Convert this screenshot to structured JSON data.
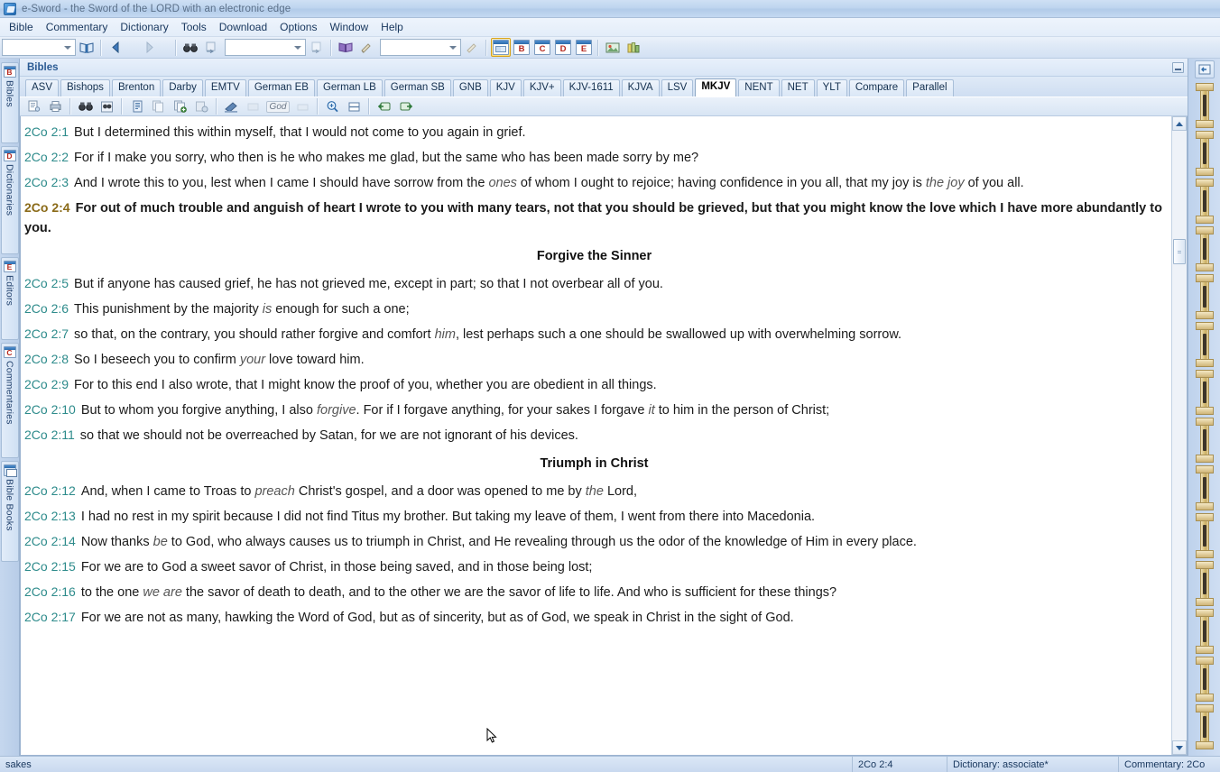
{
  "window": {
    "title": "e-Sword - the Sword of the LORD with an electronic edge",
    "app_icon": "sword-icon"
  },
  "menubar": {
    "items": [
      {
        "label": "Bible"
      },
      {
        "label": "Commentary"
      },
      {
        "label": "Dictionary"
      },
      {
        "label": "Tools"
      },
      {
        "label": "Download"
      },
      {
        "label": "Options"
      },
      {
        "label": "Window"
      },
      {
        "label": "Help"
      }
    ]
  },
  "toolbar": {
    "verse_combo_value": "",
    "search_combo_value": "",
    "topic_combo_value": "",
    "buttons": {
      "open_bible": "book-open-icon",
      "back": "back-arrow-icon",
      "back_dropdown": "chevron-down-icon",
      "forward": "forward-arrow-icon",
      "forward_dropdown": "chevron-down-icon",
      "search": "binoculars-icon",
      "search_go": "search-go-icon",
      "topic_go": "topic-go-icon",
      "dictionary": "purple-book-icon",
      "dictionary_edit": "pencil-icon",
      "last_go": "go-icon",
      "layout": "layout-icon",
      "window_b": "B",
      "window_c": "C",
      "window_d": "D",
      "window_e": "E",
      "graphic": "picture-icon",
      "charts": "charts-icon"
    }
  },
  "sidebar_left": {
    "items": [
      {
        "label": "Bibles",
        "icon": "B"
      },
      {
        "label": "Dictionaries",
        "icon": "D"
      },
      {
        "label": "Editors",
        "icon": "E"
      },
      {
        "label": "Commentaries",
        "icon": "C"
      },
      {
        "label": "Bible Books",
        "icon": "book-icon"
      }
    ]
  },
  "sidebar_right": {
    "top_button": "dock-icon",
    "scroll_icons": [
      "scroll-icon",
      "scroll-icon",
      "scroll-icon",
      "scroll-icon",
      "scroll-icon",
      "scroll-icon",
      "scroll-icon",
      "scroll-icon",
      "scroll-icon",
      "scroll-icon",
      "scroll-icon",
      "scroll-icon",
      "scroll-icon",
      "scroll-icon"
    ]
  },
  "panel": {
    "title": "Bibles",
    "minimize_icon": "minimize-icon"
  },
  "tabs": [
    {
      "label": "ASV",
      "active": false
    },
    {
      "label": "Bishops",
      "active": false
    },
    {
      "label": "Brenton",
      "active": false
    },
    {
      "label": "Darby",
      "active": false
    },
    {
      "label": "EMTV",
      "active": false
    },
    {
      "label": "German EB",
      "active": false
    },
    {
      "label": "German LB",
      "active": false
    },
    {
      "label": "German SB",
      "active": false
    },
    {
      "label": "GNB",
      "active": false
    },
    {
      "label": "KJV",
      "active": false
    },
    {
      "label": "KJV+",
      "active": false
    },
    {
      "label": "KJV-1611",
      "active": false
    },
    {
      "label": "KJVA",
      "active": false
    },
    {
      "label": "LSV",
      "active": false
    },
    {
      "label": "MKJV",
      "active": true
    },
    {
      "label": "NENT",
      "active": false
    },
    {
      "label": "NET",
      "active": false
    },
    {
      "label": "YLT",
      "active": false
    },
    {
      "label": "Compare",
      "active": false
    },
    {
      "label": "Parallel",
      "active": false
    }
  ],
  "subtoolbar": {
    "buttons": [
      "page-setup-icon",
      "print-icon",
      "search-icon",
      "search-all-icon",
      "copy-verse-icon",
      "copy-icon",
      "copy-add-icon",
      "copy-special-icon",
      "highlight-icon",
      "highlight-color-icon",
      "god-words-icon",
      "eraser-icon",
      "zoom-in-icon",
      "split-view-icon",
      "prev-chapter-icon",
      "next-chapter-icon"
    ]
  },
  "reader": {
    "blocks": [
      {
        "type": "verse",
        "ref": "2Co 2:1",
        "current": false,
        "parts": [
          {
            "t": "But I determined this within myself, that I would not come to you again in grief."
          }
        ]
      },
      {
        "type": "verse",
        "ref": "2Co 2:2",
        "current": false,
        "parts": [
          {
            "t": "For if I make you sorry, who then is he who makes me glad, but the same who has been made sorry by me?"
          }
        ]
      },
      {
        "type": "verse",
        "ref": "2Co 2:3",
        "current": false,
        "parts": [
          {
            "t": "And I wrote this to you, lest when I came I should have sorrow from the "
          },
          {
            "t": "ones",
            "i": true
          },
          {
            "t": " of whom I ought to rejoice; having confidence in you all, that my joy is "
          },
          {
            "t": "the joy",
            "i": true
          },
          {
            "t": " of you all."
          }
        ]
      },
      {
        "type": "verse",
        "ref": "2Co 2:4",
        "current": true,
        "parts": [
          {
            "t": "For out of much trouble and anguish of heart I wrote to you with many tears, not that you should be grieved, but that you might know the love which I have more abundantly to you."
          }
        ]
      },
      {
        "type": "heading",
        "text": "Forgive the Sinner"
      },
      {
        "type": "verse",
        "ref": "2Co 2:5",
        "current": false,
        "parts": [
          {
            "t": "But if anyone has caused grief, he has not grieved me, except in part; so that I not overbear all of you."
          }
        ]
      },
      {
        "type": "verse",
        "ref": "2Co 2:6",
        "current": false,
        "parts": [
          {
            "t": "This punishment by the majority "
          },
          {
            "t": "is",
            "i": true
          },
          {
            "t": " enough for such a one;"
          }
        ]
      },
      {
        "type": "verse",
        "ref": "2Co 2:7",
        "current": false,
        "parts": [
          {
            "t": "so that, on the contrary, you should rather forgive and comfort "
          },
          {
            "t": "him",
            "i": true
          },
          {
            "t": ", lest perhaps such a one should be swallowed up with overwhelming sorrow."
          }
        ]
      },
      {
        "type": "verse",
        "ref": "2Co 2:8",
        "current": false,
        "parts": [
          {
            "t": "So I beseech you to confirm "
          },
          {
            "t": "your",
            "i": true
          },
          {
            "t": " love toward him."
          }
        ]
      },
      {
        "type": "verse",
        "ref": "2Co 2:9",
        "current": false,
        "parts": [
          {
            "t": "For to this end I also wrote, that I might know the proof of you, whether you are obedient in all things."
          }
        ]
      },
      {
        "type": "verse",
        "ref": "2Co 2:10",
        "current": false,
        "parts": [
          {
            "t": "But to whom you forgive anything, I also "
          },
          {
            "t": "forgive",
            "i": true
          },
          {
            "t": ". For if I forgave anything, for your sakes I forgave "
          },
          {
            "t": "it",
            "i": true
          },
          {
            "t": " to him in the person of Christ;"
          }
        ]
      },
      {
        "type": "verse",
        "ref": "2Co 2:11",
        "current": false,
        "parts": [
          {
            "t": "so that we should not be overreached by Satan, for we are not ignorant of his devices."
          }
        ]
      },
      {
        "type": "heading",
        "text": "Triumph in Christ"
      },
      {
        "type": "verse",
        "ref": "2Co 2:12",
        "current": false,
        "parts": [
          {
            "t": "And, when I came to Troas to "
          },
          {
            "t": "preach",
            "i": true
          },
          {
            "t": " Christ's gospel, and a door was opened to me by "
          },
          {
            "t": "the",
            "i": true
          },
          {
            "t": " Lord,"
          }
        ]
      },
      {
        "type": "verse",
        "ref": "2Co 2:13",
        "current": false,
        "parts": [
          {
            "t": "I had no rest in my spirit because I did not find Titus my brother. But taking my leave of them, I went from there into Macedonia."
          }
        ]
      },
      {
        "type": "verse",
        "ref": "2Co 2:14",
        "current": false,
        "parts": [
          {
            "t": "Now thanks "
          },
          {
            "t": "be",
            "i": true
          },
          {
            "t": " to God, who always causes us to triumph in Christ, and He revealing through us the odor of the knowledge of Him in every place."
          }
        ]
      },
      {
        "type": "verse",
        "ref": "2Co 2:15",
        "current": false,
        "parts": [
          {
            "t": "For we are to God a sweet savor of Christ, in those being saved, and in those being lost;"
          }
        ]
      },
      {
        "type": "verse",
        "ref": "2Co 2:16",
        "current": false,
        "parts": [
          {
            "t": "to the one "
          },
          {
            "t": "we are",
            "i": true
          },
          {
            "t": " the savor of death to death, and to the other we are the savor of life to life. And who is sufficient for these things?"
          }
        ]
      },
      {
        "type": "verse",
        "ref": "2Co 2:17",
        "current": false,
        "parts": [
          {
            "t": "For we are not as many, hawking the Word of God, but as of sincerity, but as of God, we speak in Christ in the sight of God."
          }
        ]
      }
    ]
  },
  "statusbar": {
    "message": "sakes",
    "verse": "2Co 2:4",
    "dictionary": "Dictionary: associate*",
    "commentary": "Commentary: 2Co"
  },
  "colors": {
    "verse_ref": "#2d8b8b",
    "current_verse_ref": "#8a6a18",
    "chrome": "#c9d9ef",
    "panel_title": "#2a5a93",
    "reader_bg": "#ffffff"
  }
}
